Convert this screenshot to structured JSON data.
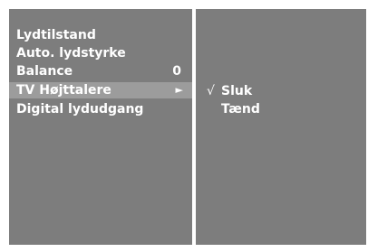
{
  "menu": {
    "items": [
      {
        "label": "Lydtilstand",
        "value": ""
      },
      {
        "label": "Auto. lydstyrke",
        "value": ""
      },
      {
        "label": "Balance",
        "value": "0"
      },
      {
        "label": "TV Højttalere",
        "value": "►"
      },
      {
        "label": "Digital lydudgang",
        "value": ""
      }
    ],
    "selected_index": 3
  },
  "submenu": {
    "options": [
      {
        "check": "√",
        "label": "Sluk"
      },
      {
        "check": "",
        "label": "Tænd"
      }
    ]
  }
}
